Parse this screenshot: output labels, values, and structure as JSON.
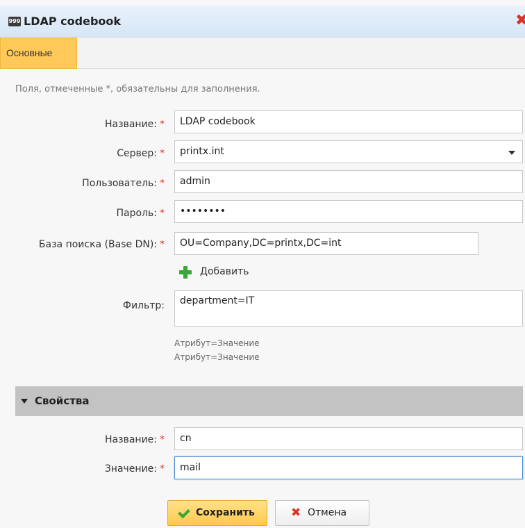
{
  "window": {
    "icon": "codebook-icon",
    "icon_text": "999",
    "title": "LDAP codebook",
    "close_icon": "close-icon"
  },
  "tabs": [
    {
      "label": "Основные",
      "active": true
    }
  ],
  "hint": "Поля, отмеченные *, обязательны для заполнения.",
  "form": {
    "required_marker": "*",
    "name": {
      "label": "Название:",
      "value": "LDAP codebook"
    },
    "server": {
      "label": "Сервер:",
      "value": "printx.int"
    },
    "user": {
      "label": "Пользователь:",
      "value": "admin"
    },
    "password": {
      "label": "Пароль:",
      "value": "••••••••"
    },
    "base_dn": {
      "label": "База поиска (Base DN):",
      "value": "OU=Company,DC=printx,DC=int"
    },
    "add": {
      "label": "Добавить",
      "icon": "plus-icon"
    },
    "filter": {
      "label": "Фильтр:",
      "value": "department=IT",
      "help_1": "Атрибут=Значение",
      "help_2": "Атрибут=Значение"
    }
  },
  "properties": {
    "title": "Свойства",
    "name": {
      "label": "Название:",
      "value": "cn"
    },
    "value": {
      "label": "Значение:",
      "value": "mail"
    }
  },
  "buttons": {
    "save": "Сохранить",
    "cancel": "Отмена"
  },
  "colors": {
    "tab_active": "#ffc95a",
    "accent_green": "#3aa63a",
    "accent_red": "#d9312b",
    "required": "#dd3333"
  }
}
